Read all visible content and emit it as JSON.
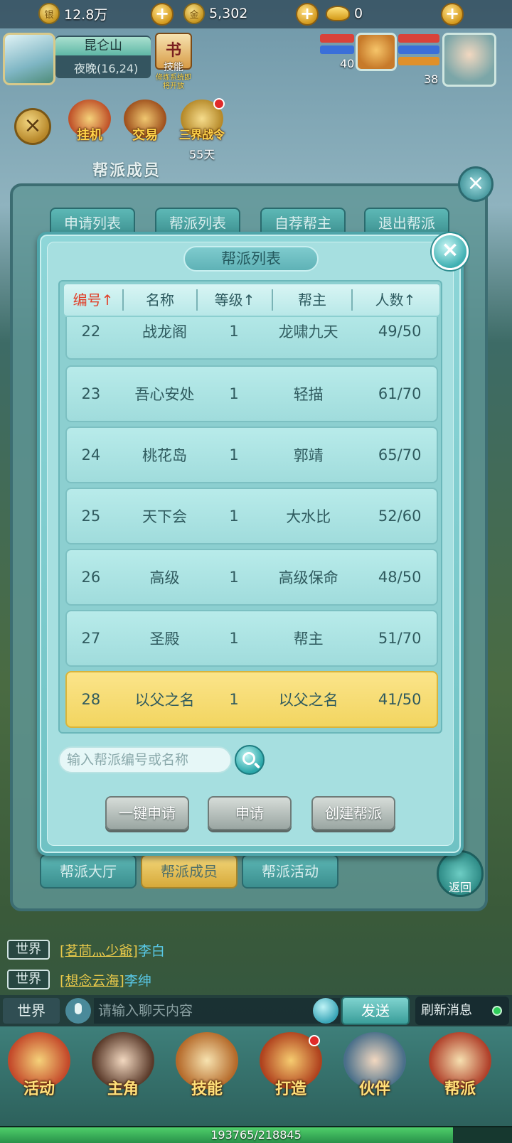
{
  "topbar": {
    "silver": "12.8万",
    "gold": "5,302",
    "ingot": "0",
    "plus": "+"
  },
  "location": {
    "name": "昆仑山",
    "time": "夜晚(16,24)"
  },
  "skill_shortcut": {
    "label": "技能",
    "sub": "修炼系统即将开放"
  },
  "party": {
    "pet_level": "40",
    "hero_level": "38"
  },
  "activities": {
    "close": "×",
    "auto": "挂机",
    "trade": "交易",
    "war_order": "三界战令",
    "war_days": "55天"
  },
  "background_panel": {
    "title": "帮派成员",
    "tabs": [
      "申请列表",
      "帮派列表",
      "自荐帮主",
      "退出帮派"
    ],
    "bottom_tabs": [
      "帮派大厅",
      "帮派成员",
      "帮派活动"
    ],
    "back": "返回",
    "close": "×"
  },
  "dialog": {
    "title": "帮派列表",
    "close": "×",
    "headers": [
      "编号↑",
      "名称",
      "等级↑",
      "帮主",
      "人数↑"
    ],
    "rows": [
      {
        "id": "22",
        "name": "战龙阁",
        "level": "1",
        "leader": "龙啸九天",
        "members": "49/50"
      },
      {
        "id": "23",
        "name": "吾心安处",
        "level": "1",
        "leader": "轻描",
        "members": "61/70"
      },
      {
        "id": "24",
        "name": "桃花岛",
        "level": "1",
        "leader": "郭靖",
        "members": "65/70"
      },
      {
        "id": "25",
        "name": "天下会",
        "level": "1",
        "leader": "大水比",
        "members": "52/60"
      },
      {
        "id": "26",
        "name": "高级",
        "level": "1",
        "leader": "高级保命",
        "members": "48/50"
      },
      {
        "id": "27",
        "name": "圣殿",
        "level": "1",
        "leader": "帮主",
        "members": "51/70"
      },
      {
        "id": "28",
        "name": "以父之名",
        "level": "1",
        "leader": "以父之名",
        "members": "41/50"
      }
    ],
    "search_placeholder": "输入帮派编号或名称",
    "buttons": [
      "一键申请",
      "申请",
      "创建帮派"
    ]
  },
  "chat": {
    "lines": [
      {
        "channel": "世界",
        "name": "[茗茼灬少爺]",
        "user": "李白"
      },
      {
        "channel": "世界",
        "name": "[想念云海]",
        "user": "李绅"
      }
    ],
    "channel": "世界",
    "input_placeholder": "请输入聊天内容",
    "send": "发送",
    "refresh": "刷新消息"
  },
  "bottom_nav": [
    "活动",
    "主角",
    "技能",
    "打造",
    "伙伴",
    "帮派"
  ],
  "exp": {
    "text": "193765/218845",
    "progress": 0.885
  },
  "colors": {
    "selected_row": "#f2d560",
    "active_header": "#e0402a",
    "dialog_bg": "#a6dfe0"
  }
}
